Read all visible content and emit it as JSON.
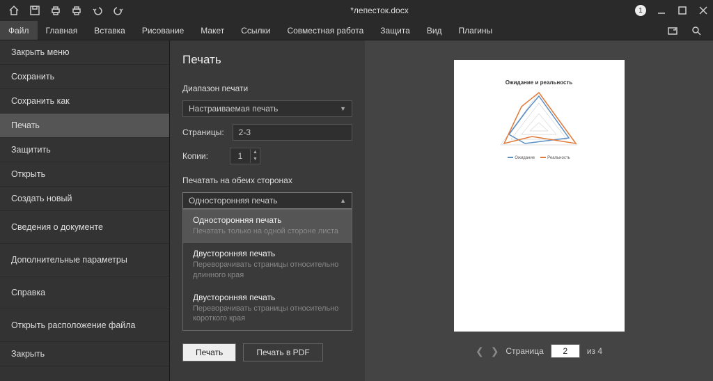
{
  "titlebar": {
    "title": "*лепесток.docx",
    "badge": "1"
  },
  "tabs": [
    "Файл",
    "Главная",
    "Вставка",
    "Рисование",
    "Макет",
    "Ссылки",
    "Совместная работа",
    "Защита",
    "Вид",
    "Плагины"
  ],
  "sidebar": [
    "Закрыть меню",
    "Сохранить",
    "Сохранить как",
    "Печать",
    "Защитить",
    "Открыть",
    "Создать новый",
    "Сведения о документе",
    "Дополнительные параметры",
    "Справка",
    "Открыть расположение файла",
    "Закрыть"
  ],
  "print": {
    "heading": "Печать",
    "range_label": "Диапазон печати",
    "range_value": "Настраиваемая печать",
    "pages_label": "Страницы:",
    "pages_value": "2-3",
    "copies_label": "Копии:",
    "copies_value": "1",
    "sides_label": "Печатать на обеих сторонах",
    "sides_value": "Односторонняя печать",
    "dropdown": [
      {
        "title": "Односторонняя печать",
        "sub": "Печатать только на одной стороне листа"
      },
      {
        "title": "Двусторонняя печать",
        "sub": "Переворачивать страницы относительно длинного края"
      },
      {
        "title": "Двусторонняя печать",
        "sub": "Переворачивать страницы относительно короткого края"
      }
    ],
    "print_btn": "Печать",
    "pdf_btn": "Печать в PDF"
  },
  "preview": {
    "chart_title": "Ожидание и реальность",
    "legend": [
      "Ожидание",
      "Реальность"
    ],
    "page_label_prefix": "Страница",
    "page_current": "2",
    "page_of": "из 4"
  },
  "chart_data": {
    "type": "radar",
    "title": "Ожидание и реальность",
    "series": [
      {
        "name": "Ожидание",
        "color": "#5a8fc6",
        "values": [
          80,
          70,
          60,
          55,
          75
        ]
      },
      {
        "name": "Реальность",
        "color": "#e07a3a",
        "values": [
          95,
          90,
          40,
          65,
          85
        ]
      }
    ]
  }
}
